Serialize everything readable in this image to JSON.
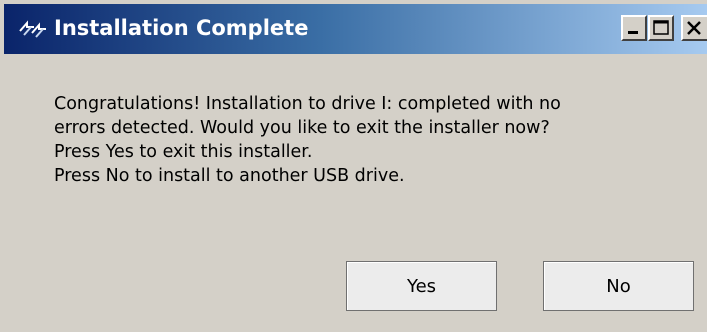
{
  "window": {
    "title": "Installation Complete",
    "title_icon": "installer-arrows-icon",
    "controls": {
      "minimize_icon": "minimize-icon",
      "maximize_icon": "maximize-icon",
      "close_icon": "close-icon"
    }
  },
  "message": {
    "lines": [
      "Congratulations!  Installation to drive I: completed with no",
      "errors detected.  Would you like to exit the installer now?",
      "Press Yes to exit this installer.",
      "Press No to install to another USB drive."
    ]
  },
  "buttons": {
    "yes_label": "Yes",
    "no_label": "No"
  },
  "colors": {
    "titlebar_start": "#0a246a",
    "titlebar_end": "#a6caf0",
    "dialog_face": "#d4d0c8"
  }
}
